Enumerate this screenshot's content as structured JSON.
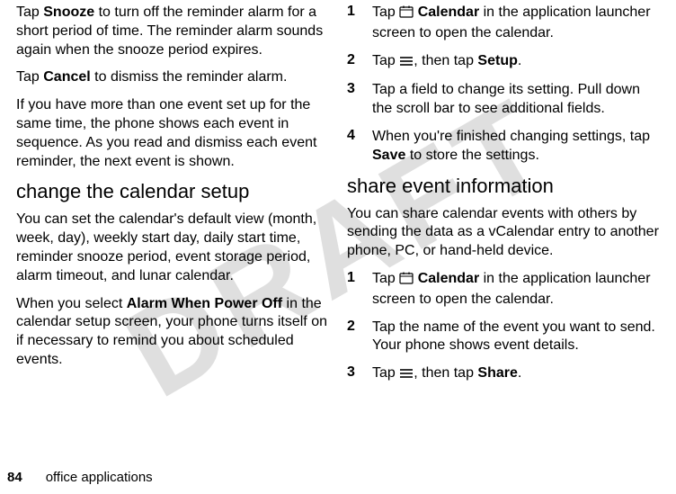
{
  "watermark": "DRAFT",
  "left": {
    "p1_a": "Tap ",
    "p1_bold": "Snooze",
    "p1_b": " to turn off the reminder alarm for a short period of time. The reminder alarm sounds again when the snooze period expires.",
    "p2_a": "Tap ",
    "p2_bold": "Cancel",
    "p2_b": " to dismiss the reminder alarm.",
    "p3": "If you have more than one event set up for the same time, the phone shows each event in sequence. As you read and dismiss each event reminder, the next event is shown.",
    "h1": "change the calendar setup",
    "p4": "You can set the calendar's default view (month, week, day), weekly start day, daily start time, reminder snooze period, event storage period, alarm timeout, and lunar calendar.",
    "p5_a": "When you select ",
    "p5_bold": "Alarm When Power Off",
    "p5_b": " in the calendar setup screen, your phone turns itself on if necessary to remind you about scheduled events."
  },
  "right": {
    "s1_a": "Tap ",
    "s1_bold": "Calendar",
    "s1_b": " in the application launcher screen to open the calendar.",
    "s2_a": "Tap ",
    "s2_b": ", then tap ",
    "s2_bold": "Setup",
    "s2_c": ".",
    "s3": "Tap a field to change its setting. Pull down the scroll bar to see additional fields.",
    "s4_a": "When you're finished changing settings, tap ",
    "s4_bold": "Save",
    "s4_b": " to store the settings.",
    "h2": "share event information",
    "p6": "You can share calendar events with others by sending the data as a vCalendar entry to another phone, PC, or hand-held device.",
    "s5_a": "Tap ",
    "s5_bold": "Calendar",
    "s5_b": " in the application launcher screen to open the calendar.",
    "s6": "Tap the name of the event you want to send. Your phone shows event details.",
    "s7_a": "Tap ",
    "s7_b": ", then tap ",
    "s7_bold": "Share",
    "s7_c": "."
  },
  "nums": {
    "n1": "1",
    "n2": "2",
    "n3": "3",
    "n4": "4",
    "b1": "1",
    "b2": "2",
    "b3": "3"
  },
  "footer": {
    "page": "84",
    "section": "office applications"
  }
}
